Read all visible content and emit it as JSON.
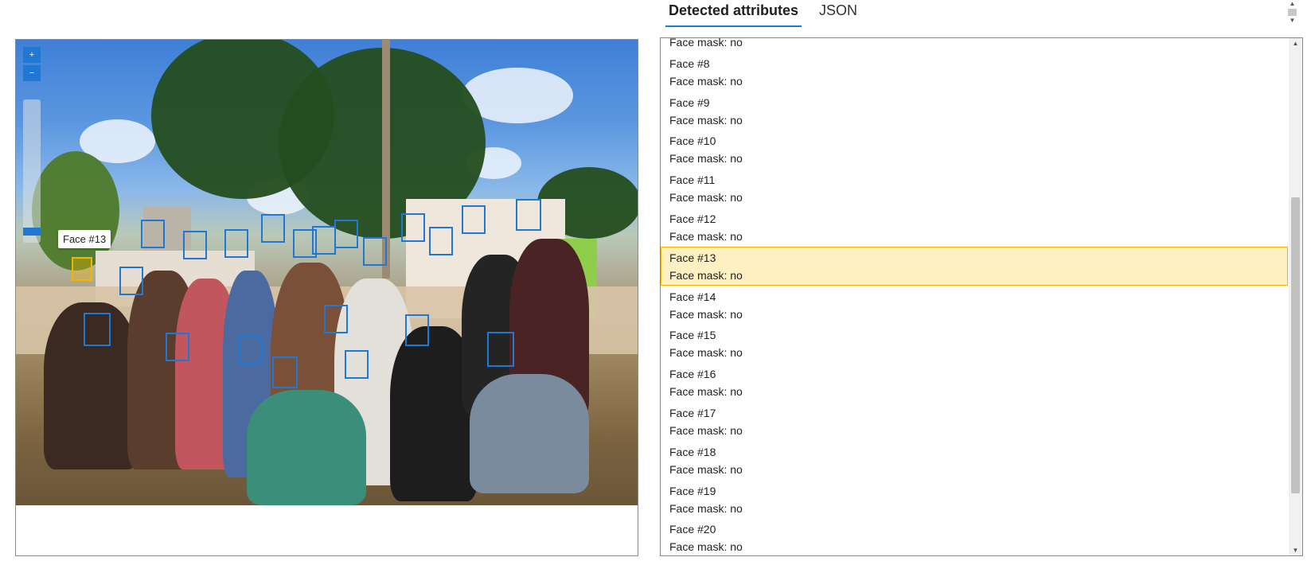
{
  "tabs": {
    "detected": "Detected attributes",
    "json": "JSON"
  },
  "image_view": {
    "tooltip": "Face #13",
    "zoom_in_symbol": "+",
    "zoom_out_symbol": "−",
    "zoom_level_fraction": 0.05,
    "selected_face": "Face #13"
  },
  "colors": {
    "accent": "#1e78d4",
    "selected_highlight": "#f4b400",
    "selected_row_bg": "#fff0c2"
  },
  "face_list": [
    {
      "name": "",
      "mask": "Face mask: no"
    },
    {
      "name": "Face #8",
      "mask": "Face mask: no"
    },
    {
      "name": "Face #9",
      "mask": "Face mask: no"
    },
    {
      "name": "Face #10",
      "mask": "Face mask: no"
    },
    {
      "name": "Face #11",
      "mask": "Face mask: no"
    },
    {
      "name": "Face #12",
      "mask": "Face mask: no"
    },
    {
      "name": "Face #13",
      "mask": "Face mask: no",
      "selected": true
    },
    {
      "name": "Face #14",
      "mask": "Face mask: no"
    },
    {
      "name": "Face #15",
      "mask": "Face mask: no"
    },
    {
      "name": "Face #16",
      "mask": "Face mask: no"
    },
    {
      "name": "Face #17",
      "mask": "Face mask: no"
    },
    {
      "name": "Face #18",
      "mask": "Face mask: no"
    },
    {
      "name": "Face #19",
      "mask": "Face mask: no"
    },
    {
      "name": "Face #20",
      "mask": "Face mask: no"
    }
  ],
  "icons": {
    "scroll_up": "▲",
    "scroll_down": "▼"
  }
}
